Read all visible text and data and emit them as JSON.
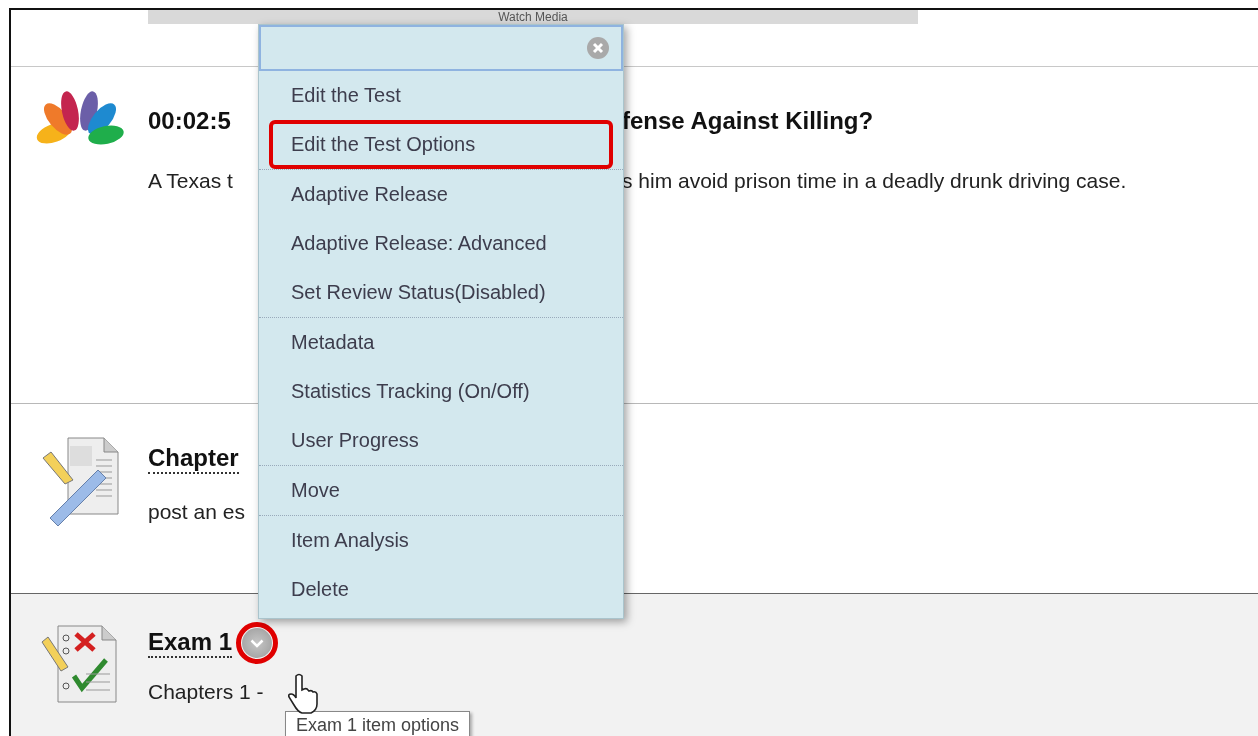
{
  "top_bar": {
    "label": "Watch Media"
  },
  "items": [
    {
      "kind": "media",
      "title": [
        "00:02:5",
        "fense Against Killing?"
      ],
      "description": [
        " A Texas t",
        "s him avoid prison time in a deadly drunk driving case."
      ]
    },
    {
      "kind": "assignment",
      "title": [
        "Chapter"
      ],
      "description": [
        "post an es"
      ]
    },
    {
      "kind": "test",
      "title": [
        "Exam 1"
      ],
      "description": [
        "Chapters 1 -"
      ],
      "options_button": {
        "highlighted": true
      }
    }
  ],
  "menu": {
    "groups": [
      [
        {
          "label": "Edit the Test",
          "highlighted": false
        },
        {
          "label": "Edit the Test Options",
          "highlighted": true
        }
      ],
      [
        {
          "label": "Adaptive Release",
          "highlighted": false
        },
        {
          "label": "Adaptive Release: Advanced",
          "highlighted": false
        },
        {
          "label": "Set Review Status(Disabled)",
          "highlighted": false
        }
      ],
      [
        {
          "label": "Metadata",
          "highlighted": false
        },
        {
          "label": "Statistics Tracking (On/Off)",
          "highlighted": false
        },
        {
          "label": "User Progress",
          "highlighted": false
        }
      ],
      [
        {
          "label": "Move",
          "highlighted": false
        }
      ],
      [
        {
          "label": "Item Analysis",
          "highlighted": false
        },
        {
          "label": "Delete",
          "highlighted": false
        }
      ]
    ]
  },
  "tooltip": "Exam 1 item options"
}
